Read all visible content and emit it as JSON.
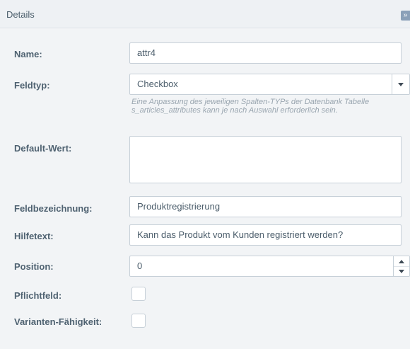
{
  "panel": {
    "title": "Details",
    "collapse_icon": "double-chevron-right-icon",
    "collapse_glyph": "»"
  },
  "form": {
    "name": {
      "label": "Name:",
      "value": "attr4"
    },
    "field_type": {
      "label": "Feldtyp:",
      "value": "Checkbox",
      "hint": "Eine Anpassung des jeweiligen Spalten-TYPs der Datenbank Tabelle s_articles_attributes kann je nach Auswahl erforderlich sein."
    },
    "default_value": {
      "label": "Default-Wert:",
      "value": ""
    },
    "field_label": {
      "label": "Feldbezeichnung:",
      "value": "Produktregistrierung"
    },
    "help_text": {
      "label": "Hilfetext:",
      "value": "Kann das Produkt vom Kunden registriert werden?"
    },
    "position": {
      "label": "Position:",
      "value": "0"
    },
    "required": {
      "label": "Pflichtfeld:",
      "checked": false
    },
    "variant_capable": {
      "label": "Varianten-Fähigkeit:",
      "checked": false
    }
  }
}
